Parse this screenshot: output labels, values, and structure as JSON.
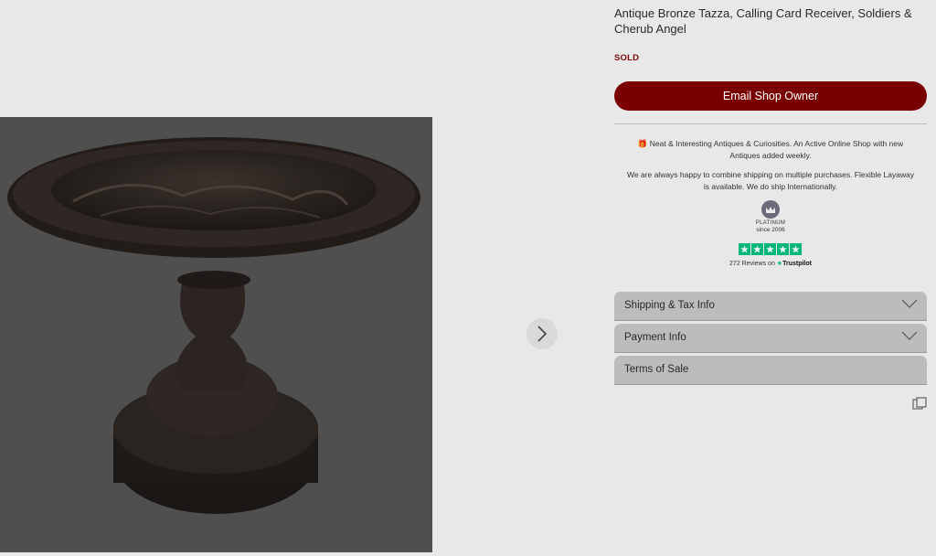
{
  "product": {
    "title": "Antique Bronze Tazza, Calling Card Receiver, Soldiers & Cherub Angel",
    "status": "SOLD",
    "email_button": "Email Shop Owner"
  },
  "shop_info": {
    "line1": "Neat & Interesting Antiques & Curiosities. An Active Online Shop with new Antiques added weekly.",
    "line2": "We are always happy to combine shipping on multiple purchases. Flexible Layaway is available. We do ship Internationally.",
    "badge_title": "PLATINUM",
    "badge_since": "since 2006",
    "reviews_text": "272 Reviews on",
    "trustpilot": "Trustpilot",
    "star_count": 5
  },
  "accordion": [
    {
      "label": "Shipping & Tax Info",
      "has_chevron": true
    },
    {
      "label": "Payment Info",
      "has_chevron": true
    },
    {
      "label": "Terms of Sale",
      "has_chevron": false
    }
  ],
  "colors": {
    "accent": "#7a0000",
    "sold": "#7a0a0a",
    "trustpilot_green": "#00b67a",
    "gallery_bg": "#4f4f4f"
  },
  "icons": {
    "gallery_next": "chevron-right-icon",
    "accordion": "chevron-down-icon",
    "share": "share-icon"
  }
}
